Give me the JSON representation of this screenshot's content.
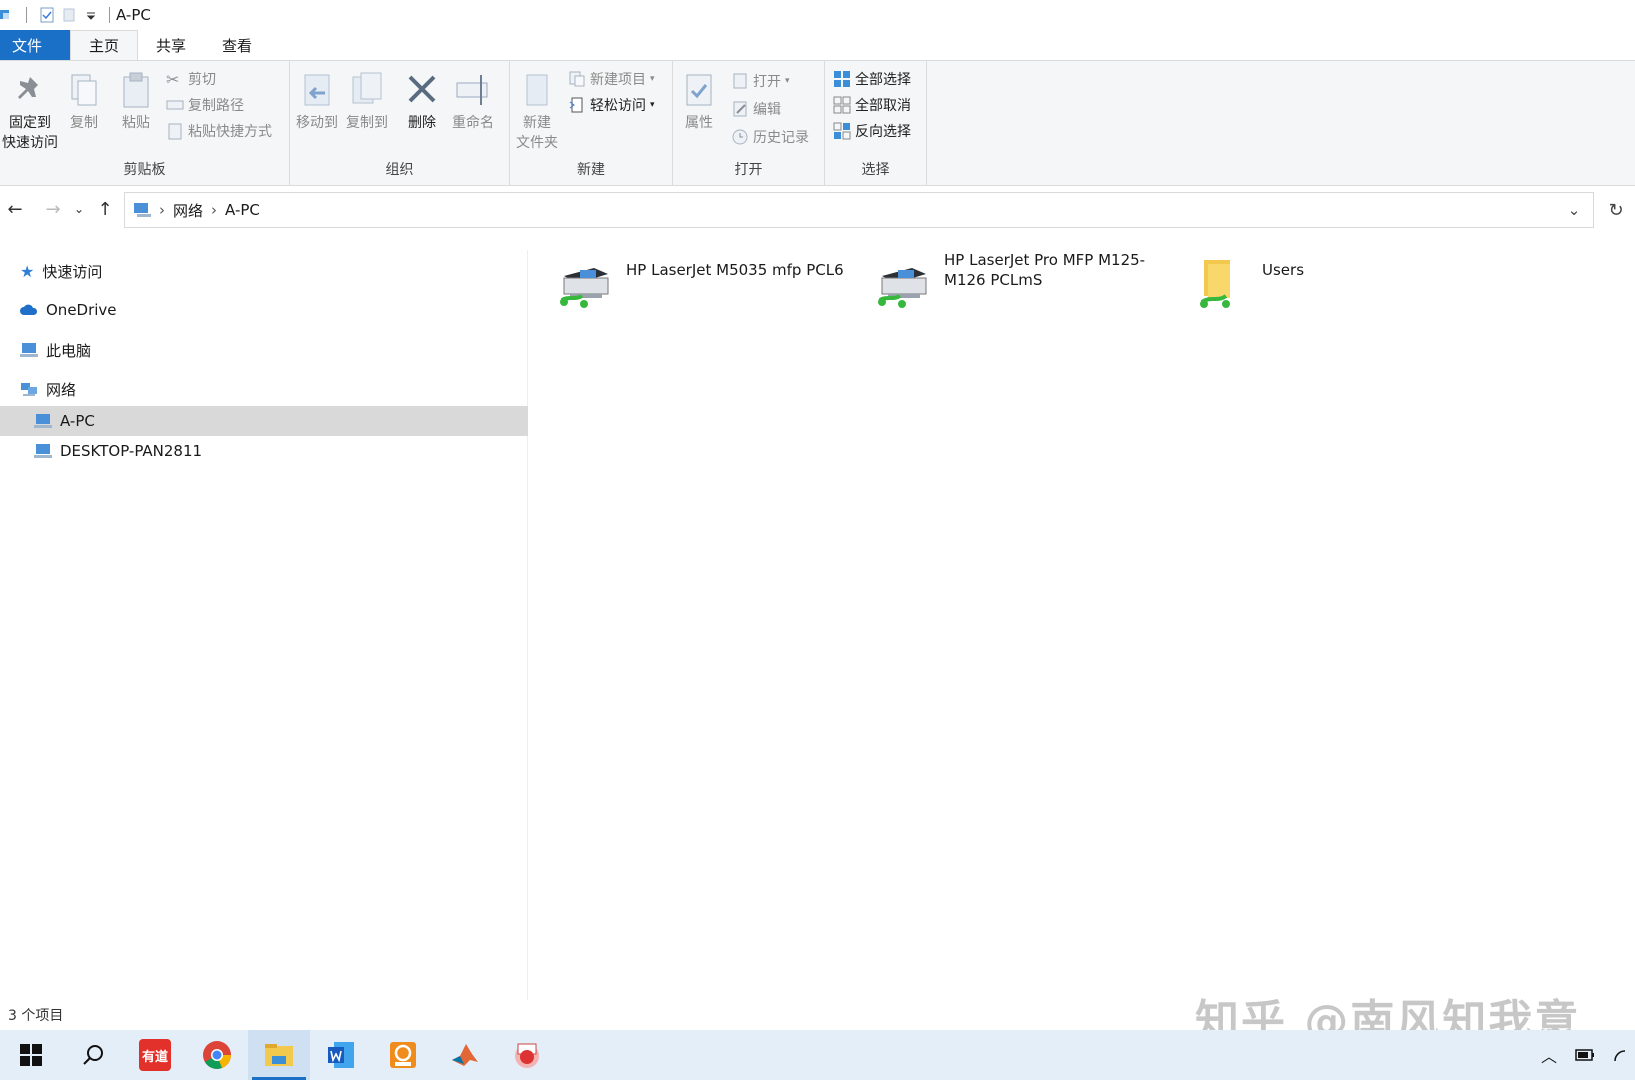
{
  "window": {
    "title": "A-PC"
  },
  "tabs": [
    {
      "label": "文件"
    },
    {
      "label": "主页"
    },
    {
      "label": "共享"
    },
    {
      "label": "查看"
    }
  ],
  "ribbon": {
    "clipboard": {
      "label": "剪贴板",
      "pin_line1": "固定到",
      "pin_line2": "快速访问",
      "copy": "复制",
      "paste": "粘贴",
      "cut": "剪切",
      "copy_path": "复制路径",
      "paste_shortcut": "粘贴快捷方式"
    },
    "organize": {
      "label": "组织",
      "move_to": "移动到",
      "copy_to": "复制到",
      "delete": "删除",
      "rename": "重命名"
    },
    "new": {
      "label": "新建",
      "new_folder_line1": "新建",
      "new_folder_line2": "文件夹",
      "new_item": "新建项目",
      "easy_access": "轻松访问"
    },
    "open": {
      "label": "打开",
      "properties": "属性",
      "open": "打开",
      "edit": "编辑",
      "history": "历史记录"
    },
    "select": {
      "label": "选择",
      "select_all": "全部选择",
      "select_none": "全部取消",
      "invert": "反向选择"
    }
  },
  "address": {
    "crumbs": [
      {
        "label": "网络"
      },
      {
        "label": "A-PC"
      }
    ]
  },
  "sidebar": {
    "items": [
      {
        "label": "快速访问",
        "icon": "star-icon"
      },
      {
        "label": "OneDrive",
        "icon": "cloud-icon"
      },
      {
        "label": "此电脑",
        "icon": "computer-icon"
      },
      {
        "label": "网络",
        "icon": "network-icon"
      },
      {
        "label": "A-PC",
        "icon": "computer-icon",
        "selected": true
      },
      {
        "label": "DESKTOP-PAN2811",
        "icon": "computer-icon"
      }
    ]
  },
  "content": {
    "items": [
      {
        "name": "HP LaserJet M5035 mfp PCL6",
        "icon": "network-printer-icon"
      },
      {
        "name": "HP LaserJet Pro MFP M125-M126 PCLmS",
        "icon": "network-printer-icon"
      },
      {
        "name": "Users",
        "icon": "shared-folder-icon"
      }
    ]
  },
  "status": {
    "count": "3 个项目"
  },
  "watermark": "知乎 @南风知我意",
  "taskbar": {
    "apps": [
      "start-icon",
      "search-icon",
      "youdao-icon",
      "chrome-icon",
      "explorer-icon",
      "word-icon",
      "pdf-icon",
      "matlab-icon",
      "app-icon"
    ],
    "youdao_label": "有道"
  },
  "colors": {
    "accent": "#1a6fc7",
    "ribbon_bg": "#f5f6f7",
    "selected_bg": "#d9d9d9"
  }
}
